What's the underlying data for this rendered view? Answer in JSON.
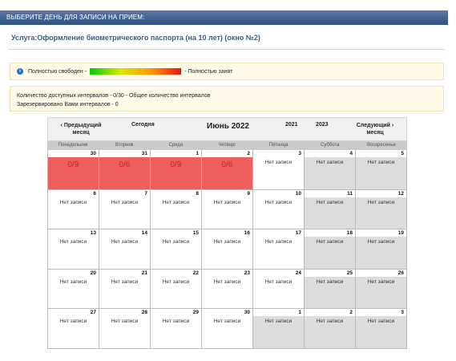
{
  "header": {
    "title": "ВЫБЕРИТЕ ДЕНЬ ДЛЯ ЗАПИСИ НА ПРИЕМ:"
  },
  "service": {
    "label": "Услуга:Оформление биометрического паспорта (на 10 лет) (окно №2)"
  },
  "legend": {
    "icon": "info-icon",
    "free_label": "Полностью свободен -",
    "busy_label": "- Полностью занят"
  },
  "stats": {
    "line1": "Количество доступных интервалов - 0/30 - Общее количество интервалов",
    "line2": "Зарезервировано Вами интервалов - 0"
  },
  "calendar": {
    "prev": "‹ Предыдущий месяц",
    "today": "Сегодня",
    "month": "Июнь 2022",
    "year_prev": "2021",
    "year_next": "2023",
    "next": "Следующий › месяц",
    "weekdays": [
      "Понедельник",
      "Вторник",
      "Среда",
      "Четверг",
      "Пятница",
      "Суббота",
      "Воскресенье"
    ],
    "weeks": [
      [
        {
          "d": "30",
          "s": "0/9",
          "t": "booked"
        },
        {
          "d": "31",
          "s": "0/6",
          "t": "booked"
        },
        {
          "d": "1",
          "s": "0/9",
          "t": "booked"
        },
        {
          "d": "2",
          "s": "0/6",
          "t": "booked"
        },
        {
          "d": "3",
          "s": "Нет записи",
          "t": "normal"
        },
        {
          "d": "4",
          "s": "Нет записи",
          "t": "weekend"
        },
        {
          "d": "5",
          "s": "Нет записи",
          "t": "weekend"
        }
      ],
      [
        {
          "d": "6",
          "s": "Нет записи",
          "t": "normal"
        },
        {
          "d": "7",
          "s": "Нет записи",
          "t": "normal"
        },
        {
          "d": "8",
          "s": "Нет записи",
          "t": "normal"
        },
        {
          "d": "9",
          "s": "Нет записи",
          "t": "normal"
        },
        {
          "d": "10",
          "s": "Нет записи",
          "t": "normal"
        },
        {
          "d": "11",
          "s": "Нет записи",
          "t": "weekend"
        },
        {
          "d": "12",
          "s": "Нет записи",
          "t": "weekend"
        }
      ],
      [
        {
          "d": "13",
          "s": "Нет записи",
          "t": "normal"
        },
        {
          "d": "14",
          "s": "Нет записи",
          "t": "normal"
        },
        {
          "d": "15",
          "s": "Нет записи",
          "t": "normal"
        },
        {
          "d": "16",
          "s": "Нет записи",
          "t": "normal"
        },
        {
          "d": "17",
          "s": "Нет записи",
          "t": "normal"
        },
        {
          "d": "18",
          "s": "Нет записи",
          "t": "weekend"
        },
        {
          "d": "19",
          "s": "Нет записи",
          "t": "weekend"
        }
      ],
      [
        {
          "d": "20",
          "s": "Нет записи",
          "t": "normal"
        },
        {
          "d": "21",
          "s": "Нет записи",
          "t": "normal"
        },
        {
          "d": "22",
          "s": "Нет записи",
          "t": "normal"
        },
        {
          "d": "23",
          "s": "Нет записи",
          "t": "normal"
        },
        {
          "d": "24",
          "s": "Нет записи",
          "t": "normal"
        },
        {
          "d": "25",
          "s": "Нет записи",
          "t": "weekend"
        },
        {
          "d": "26",
          "s": "Нет записи",
          "t": "weekend"
        }
      ],
      [
        {
          "d": "27",
          "s": "Нет записи",
          "t": "normal"
        },
        {
          "d": "28",
          "s": "Нет записи",
          "t": "normal"
        },
        {
          "d": "29",
          "s": "Нет записи",
          "t": "normal"
        },
        {
          "d": "30",
          "s": "Нет записи",
          "t": "normal"
        },
        {
          "d": "1",
          "s": "Нет записи",
          "t": "weekend"
        },
        {
          "d": "2",
          "s": "Нет записи",
          "t": "weekend"
        },
        {
          "d": "3",
          "s": "Нет записи",
          "t": "weekend"
        }
      ]
    ]
  },
  "colors": {
    "header": "#2f507f",
    "booked": "#ee5e5e",
    "weekend": "#dcdcdc",
    "service_text": "#2f5f93"
  }
}
